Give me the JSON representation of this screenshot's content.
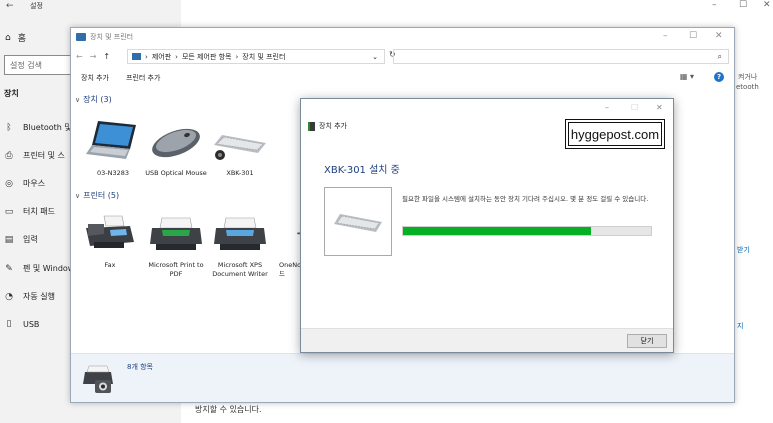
{
  "settings": {
    "back_icon": "back-arrow-icon",
    "back_glyph": "←",
    "title": "설정",
    "home_glyph": "⌂",
    "home_label": "홈",
    "search_placeholder": "설정 검색",
    "section_label": "장치",
    "nav": [
      {
        "icon": "bluetooth-icon",
        "glyph": "ᛒ",
        "label": "Bluetooth 및"
      },
      {
        "icon": "printer-icon",
        "glyph": "⎙",
        "label": "프린터 및 스"
      },
      {
        "icon": "mouse-icon",
        "glyph": "◎",
        "label": "마우스"
      },
      {
        "icon": "touchpad-icon",
        "glyph": "▭",
        "label": "터치 패드"
      },
      {
        "icon": "keyboard-icon",
        "glyph": "▤",
        "label": "입력"
      },
      {
        "icon": "pen-icon",
        "glyph": "✎",
        "label": "펜 및 Window"
      },
      {
        "icon": "autoplay-icon",
        "glyph": "◔",
        "label": "자동 실행"
      },
      {
        "icon": "usb-icon",
        "glyph": "▯",
        "label": "USB"
      }
    ],
    "right_fragments": [
      "켜거나",
      "etooth"
    ],
    "link_fragments": [
      "받기",
      "지"
    ],
    "bottom_text": "방지할 수 있습니다.",
    "window_controls": [
      "–",
      "☐",
      "✕"
    ]
  },
  "explorer": {
    "title": "장치 및 프린터",
    "window_controls": [
      "–",
      "☐",
      "✕"
    ],
    "nav_glyphs": [
      "←",
      "→",
      "↑"
    ],
    "path": [
      "제어판",
      "모든 제어판 항목",
      "장치 및 프린터"
    ],
    "path_separator": "›",
    "path_dropdown": "⌄",
    "refresh_glyph": "↻",
    "search_glyph": "⌕",
    "view_glyph": "▦ ▾",
    "help_glyph": "?",
    "commands": [
      "장치 추가",
      "프린터 추가"
    ],
    "devices_group": "장치 (3)",
    "printers_group": "프린터 (5)",
    "group_chevron": "∨",
    "devices": [
      {
        "name": "03-N3283",
        "icon": "laptop-icon"
      },
      {
        "name": "USB Optical Mouse",
        "icon": "mouse-device-icon"
      },
      {
        "name": "XBK-301",
        "icon": "keyboard-device-icon"
      }
    ],
    "printers": [
      {
        "name": "Fax",
        "icon": "fax-icon"
      },
      {
        "name": "Microsoft Print to PDF",
        "icon": "printer-device-icon"
      },
      {
        "name": "Microsoft XPS Document Writer",
        "icon": "printer-device-icon"
      },
      {
        "name": "OneNo 드",
        "icon": "printer-device-icon"
      }
    ],
    "status_text": "8개 항목"
  },
  "dialog": {
    "title": "장치 추가",
    "window_controls": [
      "–",
      "☐",
      "✕"
    ],
    "watermark": "hyggepost.com",
    "heading": "XBK-301 설치 중",
    "message": "필요한 파일을 시스템에 설치하는 동안 장치 기다려 주십시오. 몇 분 정도 걸릴 수 있습니다.",
    "progress": 0.76,
    "close_label": "닫기"
  }
}
